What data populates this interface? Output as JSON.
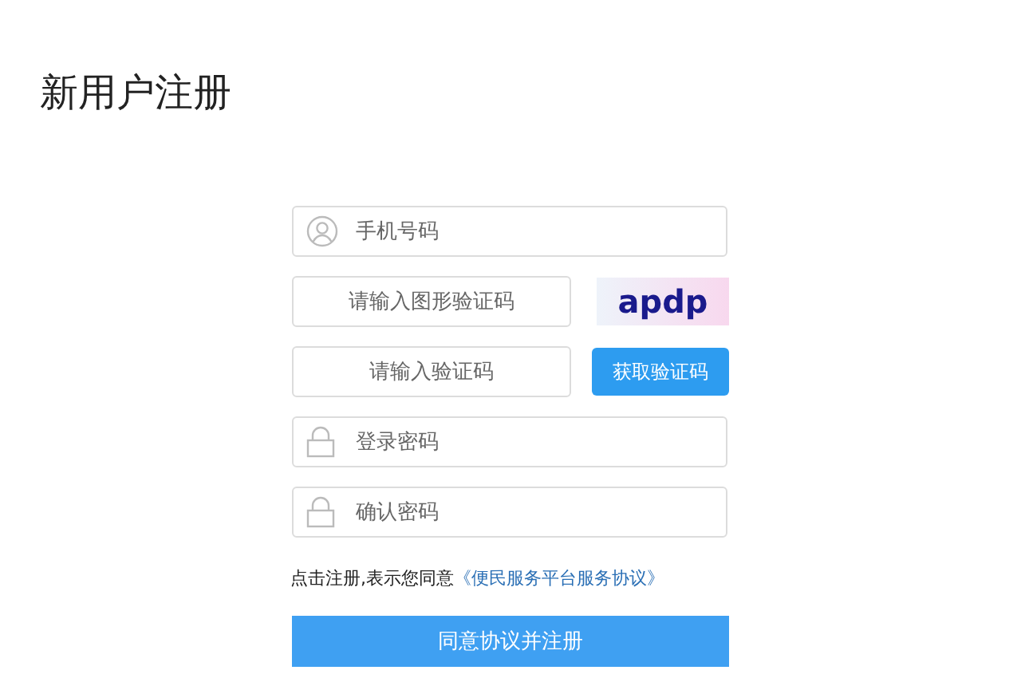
{
  "title": "新用户注册",
  "fields": [
    {
      "kind": "user",
      "placeholder": "手机号码"
    },
    {
      "kind": "captcha",
      "placeholder": "请输入图形验证码",
      "captcha_text": "apdp"
    },
    {
      "kind": "sms",
      "placeholder": "请输入验证码",
      "button": "获取验证码"
    },
    {
      "kind": "lock",
      "placeholder": "登录密码"
    },
    {
      "kind": "lock",
      "placeholder": "确认密码"
    }
  ],
  "agreement": {
    "text": "点击注册,表示您同意",
    "link": "《便民服务平台服务协议》"
  },
  "submit": "同意协议并注册"
}
